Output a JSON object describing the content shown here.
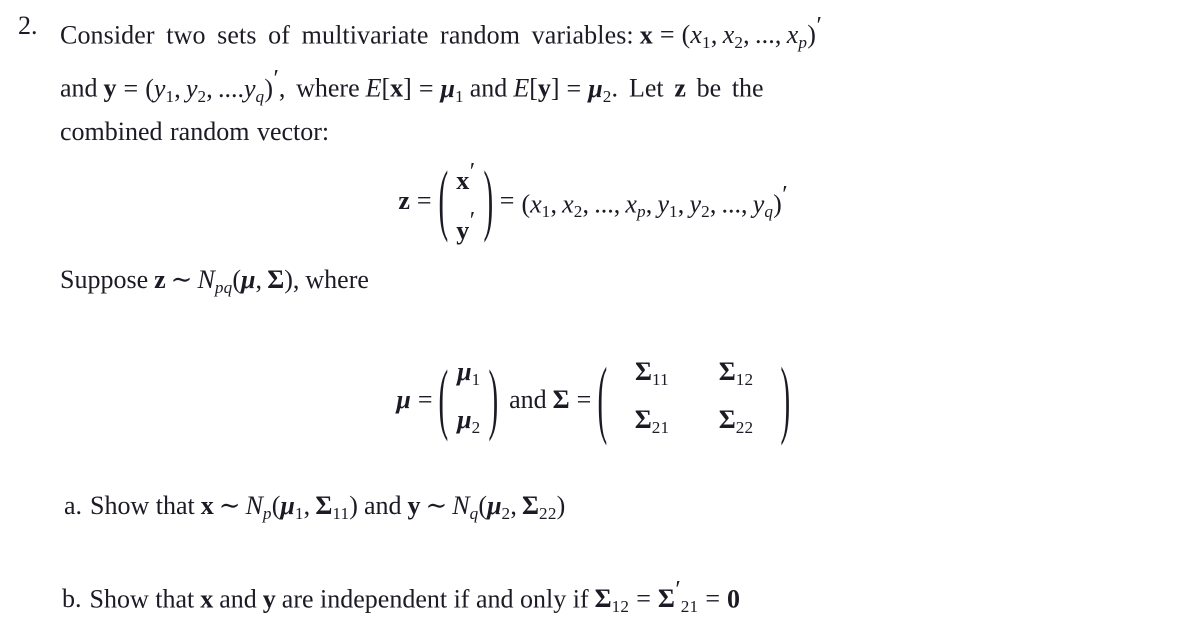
{
  "document": {
    "type": "math-problem",
    "background_color": "#ffffff",
    "text_color": "#1b1b25"
  },
  "problem": {
    "number": "2.",
    "body": {
      "line1": {
        "text_before": "Consider two sets of multivariate random variables:",
        "vector_x": "x",
        "equals": "=",
        "x_components": "(x1, x2, ..., xp)'"
      },
      "line2": {
        "and": "and",
        "vector_y": "y",
        "y_components": "(y1, y2, ....yq)'",
        "where": ", where",
        "expectation_x": "E[x]",
        "mu1": "μ1",
        "and2": "and",
        "expectation_y": "E[y]",
        "mu2": "μ2.",
        "let_z": "Let z be the"
      },
      "line3": {
        "text": "combined random vector:"
      }
    }
  },
  "equation_z": {
    "lhs": "z",
    "equals": "=",
    "matrix": {
      "rows": [
        {
          "cells": [
            "x'"
          ]
        },
        {
          "cells": [
            "y'"
          ]
        }
      ]
    },
    "equals2": "=",
    "rhs": "(x1, x2, ..., xp, y1, y2, ..., yq)'",
    "rhs_parts": {
      "open": "(",
      "x1": "x",
      "x1sub": "1",
      "x2": "x",
      "x2sub": "2",
      "ellipsis1": "...",
      "xp": "x",
      "xpsub": "p",
      "y1": "y",
      "y1sub": "1",
      "y2": "y",
      "y2sub": "2",
      "ellipsis2": "...",
      "yq": "y",
      "yqsub": "q",
      "close": ")",
      "prime": "′"
    }
  },
  "suppose_line": {
    "suppose": "Suppose",
    "z": "z",
    "tilde": "~",
    "N": "N",
    "N_subscript": "pq",
    "args": "(μ, Σ),",
    "mu": "μ",
    "comma": ",",
    "sigma": "Σ",
    "where": "where"
  },
  "equation_mu_sigma": {
    "mu_symbol": "μ",
    "equals": "=",
    "mu_matrix": {
      "rows": [
        {
          "cells": [
            "μ1"
          ]
        },
        {
          "cells": [
            "μ2"
          ]
        }
      ],
      "subscripts": [
        "1",
        "2"
      ]
    },
    "connector": "and",
    "sigma_symbol": "Σ",
    "equals2": "=",
    "sigma_matrix": {
      "rows": [
        {
          "cells": [
            "Σ11",
            "Σ12"
          ]
        },
        {
          "cells": [
            "Σ21",
            "Σ22"
          ]
        }
      ],
      "subscripts": [
        [
          "11",
          "12"
        ],
        [
          "21",
          "22"
        ]
      ]
    }
  },
  "parts": {
    "a": {
      "label": "a.",
      "show_that": "Show that",
      "x": "x",
      "tilde1": "~",
      "Np": "N",
      "Np_sub": "p",
      "args1_open": "(",
      "mu1": "μ",
      "mu1_sub": "1",
      "comma1": ",",
      "sigma11": "Σ",
      "sigma11_sub": "11",
      "args1_close": ")",
      "and": "and",
      "y": "y",
      "tilde2": "~",
      "Nq": "N",
      "Nq_sub": "q",
      "args2_open": "(",
      "mu2": "μ",
      "mu2_sub": "2",
      "comma2": ",",
      "sigma22": "Σ",
      "sigma22_sub": "22",
      "args2_close": ")"
    },
    "b": {
      "label": "b.",
      "show_that": "Show that",
      "x": "x",
      "and1": "and",
      "y": "y",
      "are_independent": "are independent if and only if",
      "sigma12": "Σ",
      "sigma12_sub": "12",
      "equals1": "=",
      "sigma21": "Σ",
      "sigma21_prime": "′",
      "sigma21_sub": "21",
      "equals2": "=",
      "zero": "0"
    }
  },
  "symbols": {
    "paren_open": "(",
    "paren_close": ")",
    "prime": "′",
    "tilde": "~",
    "equals": "=",
    "mu": "μ",
    "Sigma": "Σ",
    "comma": ",",
    "ellipsis": "...",
    "ellipsis_tight": "...."
  }
}
